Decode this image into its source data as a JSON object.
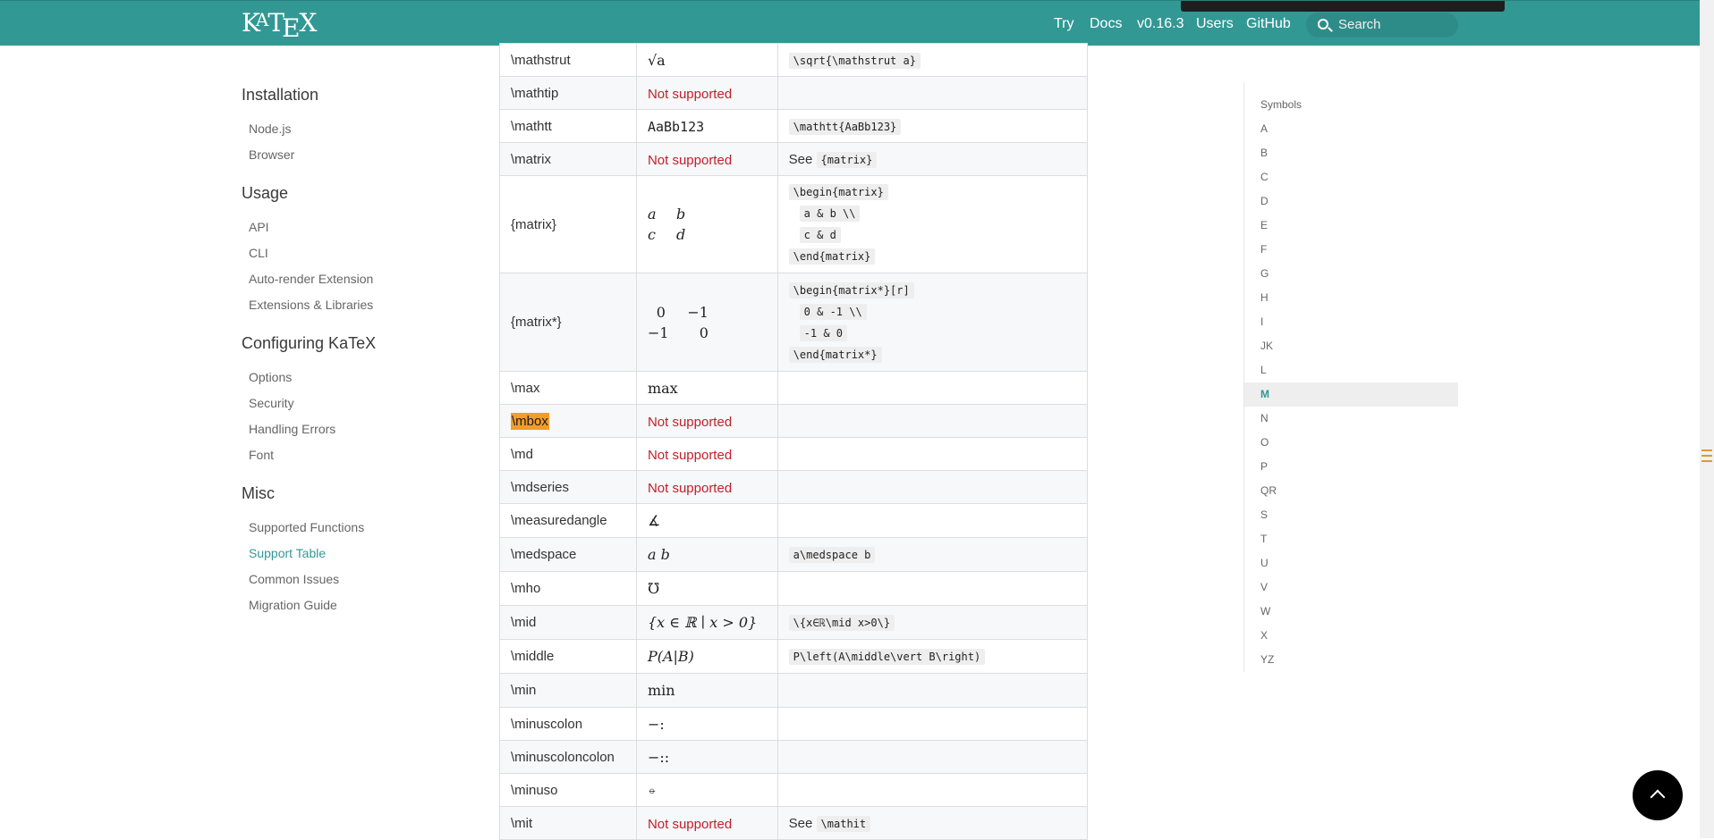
{
  "header": {
    "logo": {
      "k": "K",
      "a": "A",
      "t": "T",
      "e": "E",
      "x": "X"
    },
    "nav": [
      "Try",
      "Docs",
      "v0.16.3",
      "Users",
      "GitHub"
    ],
    "search_placeholder": "Search"
  },
  "sidebar": {
    "groups": [
      {
        "title": "Installation",
        "items": [
          "Node.js",
          "Browser"
        ]
      },
      {
        "title": "Usage",
        "items": [
          "API",
          "CLI",
          "Auto-render Extension",
          "Extensions & Libraries"
        ]
      },
      {
        "title": "Configuring KaTeX",
        "items": [
          "Options",
          "Security",
          "Handling Errors",
          "Font"
        ]
      },
      {
        "title": "Misc",
        "items": [
          "Supported Functions",
          "Support Table",
          "Common Issues",
          "Migration Guide"
        ]
      }
    ],
    "active": "Support Table"
  },
  "table": {
    "rows": [
      {
        "cmd": "\\mathstrut",
        "render": "√a",
        "code": [
          "\\sqrt{\\mathstrut a}"
        ]
      },
      {
        "cmd": "\\mathtip",
        "render": "Not supported"
      },
      {
        "cmd": "\\mathtt",
        "render": "AaBb123",
        "code": [
          "\\mathtt{AaBb123}"
        ]
      },
      {
        "cmd": "\\matrix",
        "render": "Not supported",
        "see": "See",
        "code": [
          "{matrix}"
        ]
      },
      {
        "cmd": "{matrix}",
        "matrix": [
          "a",
          "b",
          "c",
          "d"
        ],
        "code": [
          "\\begin{matrix}",
          "a & b \\\\",
          "c & d",
          "\\end{matrix}"
        ]
      },
      {
        "cmd": "{matrix*}",
        "matrix": [
          "0",
          "−1",
          "−1",
          "0"
        ],
        "code": [
          "\\begin{matrix*}[r]",
          "0 & -1 \\\\",
          "-1 & 0",
          "\\end{matrix*}"
        ]
      },
      {
        "cmd": "\\max",
        "render": "max"
      },
      {
        "cmd": "\\mbox",
        "render": "Not supported"
      },
      {
        "cmd": "\\md",
        "render": "Not supported"
      },
      {
        "cmd": "\\mdseries",
        "render": "Not supported"
      },
      {
        "cmd": "\\measuredangle",
        "render": "∡"
      },
      {
        "cmd": "\\medspace",
        "render": "a b",
        "code": [
          "a\\medspace b"
        ]
      },
      {
        "cmd": "\\mho",
        "render": "℧"
      },
      {
        "cmd": "\\mid",
        "render": "{x ∈ ℝ ∣ x > 0}",
        "code": [
          "\\{x∈ℝ\\mid x>0\\}"
        ]
      },
      {
        "cmd": "\\middle",
        "render": "P(A|B)",
        "code": [
          "P\\left(A\\middle\\vert B\\right)"
        ]
      },
      {
        "cmd": "\\min",
        "render": "min"
      },
      {
        "cmd": "\\minuscolon",
        "render": "−:"
      },
      {
        "cmd": "\\minuscoloncolon",
        "render": "−::"
      },
      {
        "cmd": "\\minuso",
        "render": "⦵"
      },
      {
        "cmd": "\\mit",
        "render": "Not supported",
        "see": "See",
        "code": [
          "\\mathit"
        ]
      }
    ]
  },
  "toc": {
    "items": [
      "Symbols",
      "A",
      "B",
      "C",
      "D",
      "E",
      "F",
      "G",
      "H",
      "I",
      "JK",
      "L",
      "M",
      "N",
      "O",
      "P",
      "QR",
      "S",
      "T",
      "U",
      "V",
      "W",
      "X",
      "YZ"
    ],
    "active": "M"
  },
  "colors": {
    "header_bg": "#329894",
    "accent": "#329894",
    "not_supported": "#c0202a",
    "highlight": "#f39c2a"
  }
}
